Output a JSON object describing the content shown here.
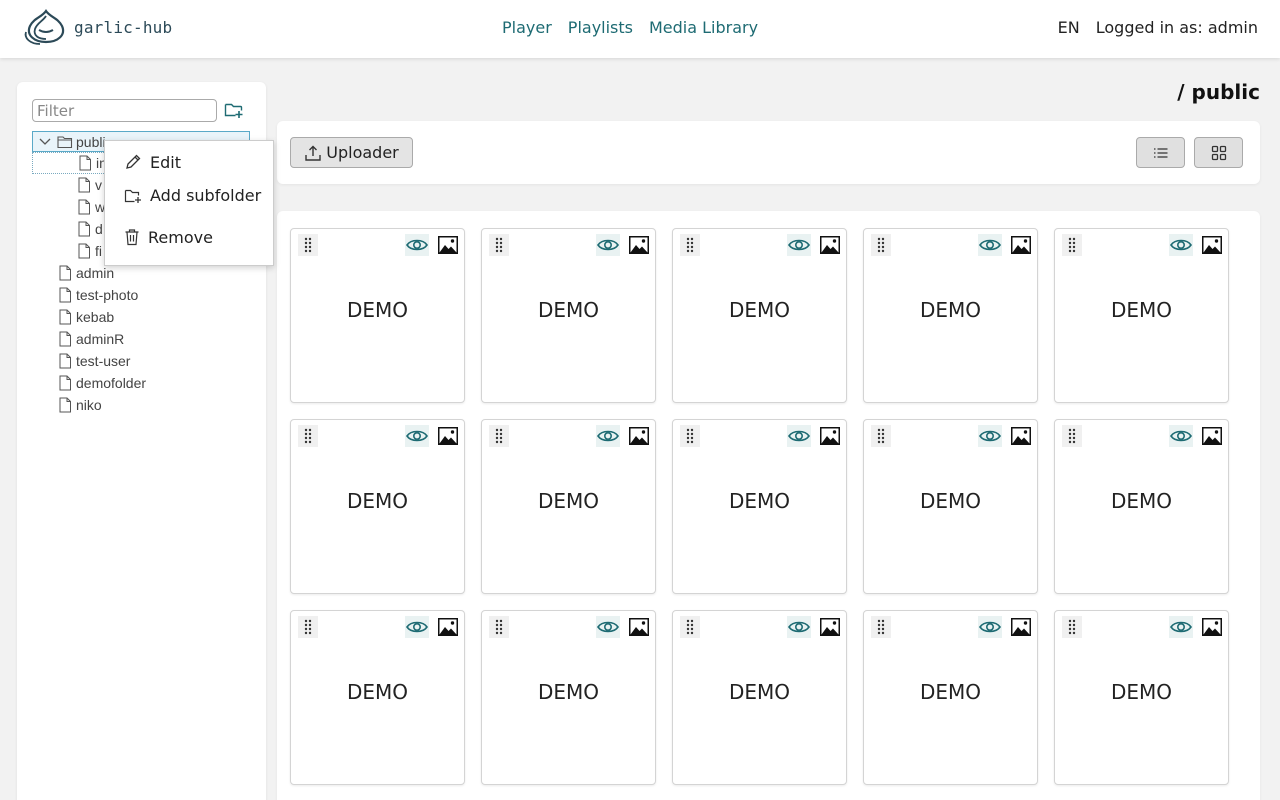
{
  "header": {
    "logo_text": "garlic-hub",
    "nav": [
      "Player",
      "Playlists",
      "Media Library"
    ],
    "language": "EN",
    "user_status": "Logged in as: admin"
  },
  "sidebar": {
    "filter_placeholder": "Filter",
    "tree": {
      "root": {
        "label": "publi",
        "expanded": true,
        "selected": true
      },
      "children": [
        {
          "label": "in"
        },
        {
          "label": "v"
        },
        {
          "label": "w"
        },
        {
          "label": "d"
        },
        {
          "label": "fi"
        }
      ],
      "top_level": [
        "admin",
        "test-photo",
        "kebab",
        "adminR",
        "test-user",
        "demofolder",
        "niko"
      ]
    }
  },
  "context_menu": {
    "items": [
      {
        "label": "Edit",
        "icon": "pencil-icon"
      },
      {
        "label": "Add subfolder",
        "icon": "folder-plus-icon"
      },
      {
        "label": "Remove",
        "icon": "trash-icon"
      }
    ]
  },
  "main": {
    "path_title": "/ public",
    "toolbar": {
      "uploader_label": "Uploader",
      "view_modes": [
        "list",
        "grid"
      ]
    },
    "media_items": [
      "DEMO",
      "DEMO",
      "DEMO",
      "DEMO",
      "DEMO",
      "DEMO",
      "DEMO",
      "DEMO",
      "DEMO",
      "DEMO",
      "DEMO",
      "DEMO",
      "DEMO",
      "DEMO",
      "DEMO"
    ]
  },
  "colors": {
    "accent": "#1e6b73",
    "selection": "#5aa9c8"
  }
}
